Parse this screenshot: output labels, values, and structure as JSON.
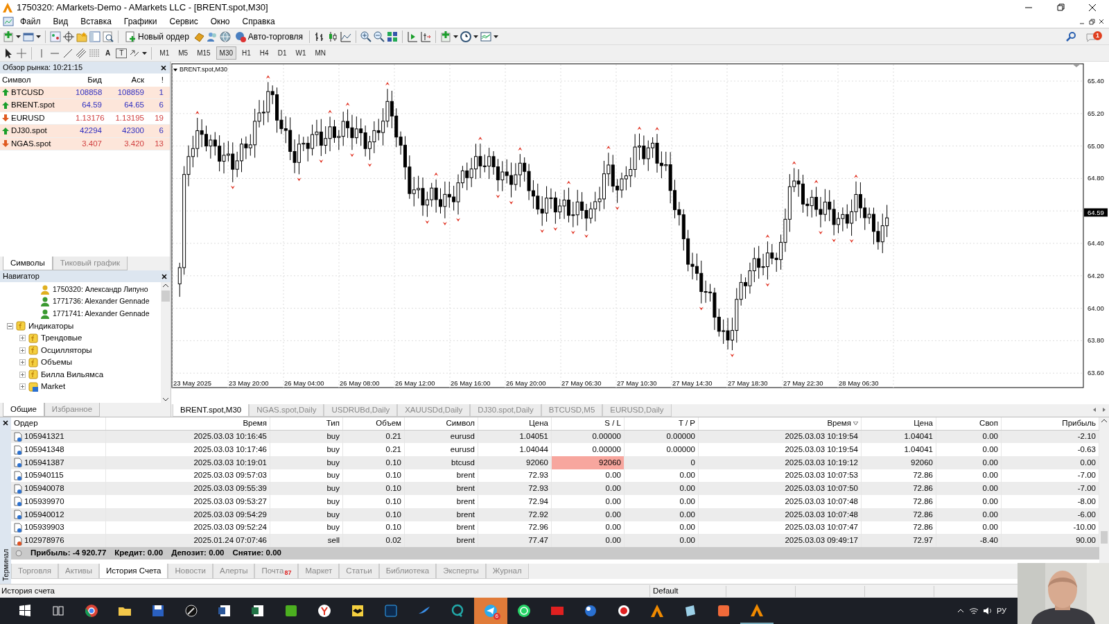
{
  "window": {
    "title": "1750320: AMarkets-Demo - AMarkets LLC - [BRENT.spot,M30]"
  },
  "menu": [
    "Файл",
    "Вид",
    "Вставка",
    "Графики",
    "Сервис",
    "Окно",
    "Справка"
  ],
  "toolbar": {
    "buttons": [
      "Новый ордер",
      "Авто-торговля"
    ],
    "notification_count": "1"
  },
  "drawing_toolbar": {
    "text_tool": "A",
    "label_tool": "T"
  },
  "timeframes": [
    {
      "label": "M1",
      "selected": false
    },
    {
      "label": "M5",
      "selected": false
    },
    {
      "label": "M15",
      "selected": false
    },
    {
      "label": "M30",
      "selected": true
    },
    {
      "label": "H1",
      "selected": false
    },
    {
      "label": "H4",
      "selected": false
    },
    {
      "label": "D1",
      "selected": false
    },
    {
      "label": "W1",
      "selected": false
    },
    {
      "label": "MN",
      "selected": false
    }
  ],
  "market_watch": {
    "title": "Обзор рынка: 10:21:15",
    "columns": [
      "Символ",
      "Бид",
      "Аск",
      "!"
    ],
    "rows": [
      {
        "symbol": "BTCUSD",
        "bid": "108858",
        "ask": "108859",
        "spread": "1",
        "rising": true,
        "highlighted": true
      },
      {
        "symbol": "BRENT.spot",
        "bid": "64.59",
        "ask": "64.65",
        "spread": "6",
        "rising": true,
        "highlighted": true
      },
      {
        "symbol": "EURUSD",
        "bid": "1.13176",
        "ask": "1.13195",
        "spread": "19",
        "rising": false,
        "highlighted": false
      },
      {
        "symbol": "DJ30.spot",
        "bid": "42294",
        "ask": "42300",
        "spread": "6",
        "rising": true,
        "highlighted": true
      },
      {
        "symbol": "NGAS.spot",
        "bid": "3.407",
        "ask": "3.420",
        "spread": "13",
        "rising": false,
        "highlighted": true
      }
    ],
    "tabs": [
      {
        "label": "Символы",
        "selected": true
      },
      {
        "label": "Тиковый график",
        "selected": false
      }
    ]
  },
  "navigator": {
    "title": "Навигатор",
    "accounts": [
      {
        "label": "1750320: Александр Липуно",
        "active": true
      },
      {
        "label": "1771736: Alexander Gennade",
        "active": false
      },
      {
        "label": "1771741: Alexander Gennade",
        "active": false
      }
    ],
    "tree": [
      {
        "label": "Индикаторы",
        "kind": "folder",
        "expanded": true,
        "children": [
          {
            "label": "Трендовые",
            "kind": "folder",
            "expanded": false
          },
          {
            "label": "Осцилляторы",
            "kind": "folder",
            "expanded": false
          },
          {
            "label": "Объемы",
            "kind": "folder",
            "expanded": false
          },
          {
            "label": "Билла Вильямса",
            "kind": "folder",
            "expanded": false
          },
          {
            "label": "Market",
            "kind": "market",
            "expanded": false
          }
        ]
      }
    ],
    "tabs": [
      {
        "label": "Общие",
        "selected": true
      },
      {
        "label": "Избранное",
        "selected": false
      }
    ]
  },
  "chart": {
    "title": "BRENT.spot,M30",
    "price_ticks": [
      "65.40",
      "65.20",
      "65.00",
      "64.80",
      "64.40",
      "64.20",
      "64.00",
      "63.80",
      "63.60"
    ],
    "current_price": "64.59",
    "time_labels": [
      "23 May 2025",
      "23 May 20:00",
      "26 May 04:00",
      "26 May 08:00",
      "26 May 12:00",
      "26 May 16:00",
      "26 May 20:00",
      "27 May 06:30",
      "27 May 10:30",
      "27 May 14:30",
      "27 May 18:30",
      "27 May 22:30",
      "28 May 06:30"
    ]
  },
  "chart_tabs": [
    {
      "label": "BRENT.spot,M30",
      "selected": true
    },
    {
      "label": "NGAS.spot,Daily",
      "selected": false
    },
    {
      "label": "USDRUBd,Daily",
      "selected": false
    },
    {
      "label": "XAUUSDd,Daily",
      "selected": false
    },
    {
      "label": "DJ30.spot,Daily",
      "selected": false
    },
    {
      "label": "BTCUSD,M5",
      "selected": false
    },
    {
      "label": "EURUSD,Daily",
      "selected": false
    }
  ],
  "terminal": {
    "side_label": "Терминал",
    "columns": [
      {
        "label": "Ордер",
        "sorted": false
      },
      {
        "label": "Время",
        "sorted": false
      },
      {
        "label": "Тип",
        "sorted": false
      },
      {
        "label": "Объем",
        "sorted": false
      },
      {
        "label": "Символ",
        "sorted": false
      },
      {
        "label": "Цена",
        "sorted": false
      },
      {
        "label": "S / L",
        "sorted": false
      },
      {
        "label": "T / P",
        "sorted": false
      },
      {
        "label": "Время",
        "sorted": true
      },
      {
        "label": "Цена",
        "sorted": false
      },
      {
        "label": "Своп",
        "sorted": false
      },
      {
        "label": "Прибыль",
        "sorted": false
      }
    ],
    "rows": [
      {
        "kind": "buy",
        "cells": [
          "105941321",
          "2025.03.03 10:16:45",
          "buy",
          "0.21",
          "eurusd",
          "1.04051",
          "0.00000",
          "0.00000",
          "2025.03.03 10:19:54",
          "1.04041",
          "0.00",
          "-2.10"
        ],
        "sl_hit": false
      },
      {
        "kind": "buy",
        "cells": [
          "105941348",
          "2025.03.03 10:17:46",
          "buy",
          "0.21",
          "eurusd",
          "1.04044",
          "0.00000",
          "0.00000",
          "2025.03.03 10:19:54",
          "1.04041",
          "0.00",
          "-0.63"
        ],
        "sl_hit": false
      },
      {
        "kind": "buy",
        "cells": [
          "105941387",
          "2025.03.03 10:19:01",
          "buy",
          "0.10",
          "btcusd",
          "92060",
          "92060",
          "0",
          "2025.03.03 10:19:12",
          "92060",
          "0.00",
          "0.00"
        ],
        "sl_hit": true
      },
      {
        "kind": "buy",
        "cells": [
          "105940115",
          "2025.03.03 09:57:03",
          "buy",
          "0.10",
          "brent",
          "72.93",
          "0.00",
          "0.00",
          "2025.03.03 10:07:53",
          "72.86",
          "0.00",
          "-7.00"
        ],
        "sl_hit": false
      },
      {
        "kind": "buy",
        "cells": [
          "105940078",
          "2025.03.03 09:55:39",
          "buy",
          "0.10",
          "brent",
          "72.93",
          "0.00",
          "0.00",
          "2025.03.03 10:07:50",
          "72.86",
          "0.00",
          "-7.00"
        ],
        "sl_hit": false
      },
      {
        "kind": "buy",
        "cells": [
          "105939970",
          "2025.03.03 09:53:27",
          "buy",
          "0.10",
          "brent",
          "72.94",
          "0.00",
          "0.00",
          "2025.03.03 10:07:48",
          "72.86",
          "0.00",
          "-8.00"
        ],
        "sl_hit": false
      },
      {
        "kind": "buy",
        "cells": [
          "105940012",
          "2025.03.03 09:54:29",
          "buy",
          "0.10",
          "brent",
          "72.92",
          "0.00",
          "0.00",
          "2025.03.03 10:07:48",
          "72.86",
          "0.00",
          "-6.00"
        ],
        "sl_hit": false
      },
      {
        "kind": "buy",
        "cells": [
          "105939903",
          "2025.03.03 09:52:24",
          "buy",
          "0.10",
          "brent",
          "72.96",
          "0.00",
          "0.00",
          "2025.03.03 10:07:47",
          "72.86",
          "0.00",
          "-10.00"
        ],
        "sl_hit": false
      },
      {
        "kind": "sell",
        "cells": [
          "102978976",
          "2025.01.24 07:07:46",
          "sell",
          "0.02",
          "brent",
          "77.47",
          "0.00",
          "0.00",
          "2025.03.03 09:49:17",
          "72.97",
          "-8.40",
          "90.00"
        ],
        "sl_hit": false
      }
    ],
    "summary": [
      "Прибыль: -4 920.77",
      "Кредит: 0.00",
      "Депозит: 0.00",
      "Снятие: 0.00"
    ],
    "tabs": [
      {
        "label": "Торговля",
        "selected": false
      },
      {
        "label": "Активы",
        "selected": false
      },
      {
        "label": "История Счета",
        "selected": true
      },
      {
        "label": "Новости",
        "selected": false
      },
      {
        "label": "Алерты",
        "selected": false
      },
      {
        "label": "Почта",
        "selected": false,
        "badge": "87"
      },
      {
        "label": "Маркет",
        "selected": false
      },
      {
        "label": "Статьи",
        "selected": false
      },
      {
        "label": "Библиотека",
        "selected": false
      },
      {
        "label": "Эксперты",
        "selected": false
      },
      {
        "label": "Журнал",
        "selected": false
      }
    ]
  },
  "status_bar": [
    "История счета",
    "Default"
  ],
  "taskbar": {
    "badge": "6",
    "language": "РУ"
  }
}
